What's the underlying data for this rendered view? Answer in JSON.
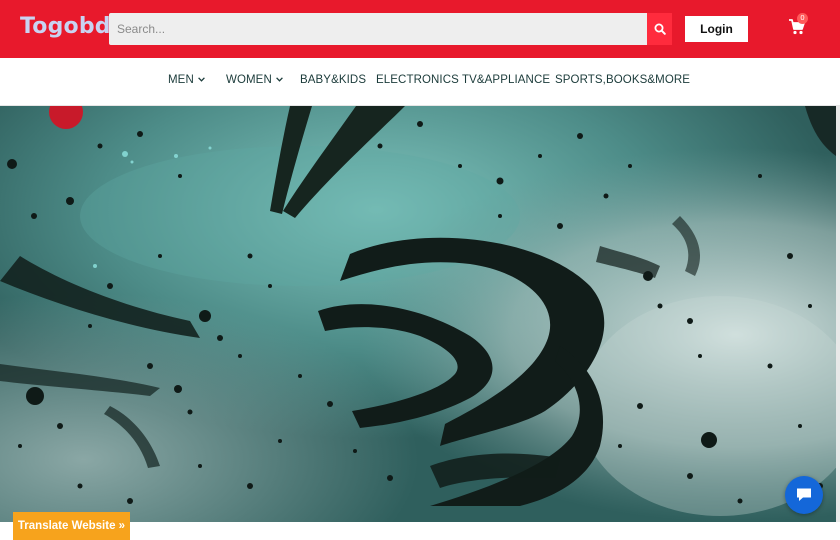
{
  "header": {
    "logo": "Togobd",
    "search": {
      "placeholder": "Search..."
    },
    "search_icon": "search-icon",
    "login_label": "Login",
    "cart": {
      "icon": "cart-icon",
      "count": "0"
    }
  },
  "nav": {
    "items": [
      {
        "label": "MEN",
        "has_dropdown": true
      },
      {
        "label": "WOMEN",
        "has_dropdown": true
      },
      {
        "label": "BABY&KIDS",
        "has_dropdown": false
      },
      {
        "label": "ELECTRONICS",
        "has_dropdown": false
      },
      {
        "label": "TV&APPLIANCE",
        "has_dropdown": false
      },
      {
        "label": "SPORTS,BOOKS&MORE",
        "has_dropdown": false
      }
    ]
  },
  "hero": {
    "image": "teal-ink-splatter-banner"
  },
  "translate_label": "Translate Website »",
  "chat_icon": "chat-bubble-icon",
  "colors": {
    "header_bg": "#e8192c",
    "logo": "#c9d3f2",
    "search_button": "#ff2b3d",
    "nav_text": "#1b3b3a",
    "translate_bg": "#f7a31c",
    "chat_bg": "#1467d9",
    "hero_base": "#3a7270"
  }
}
